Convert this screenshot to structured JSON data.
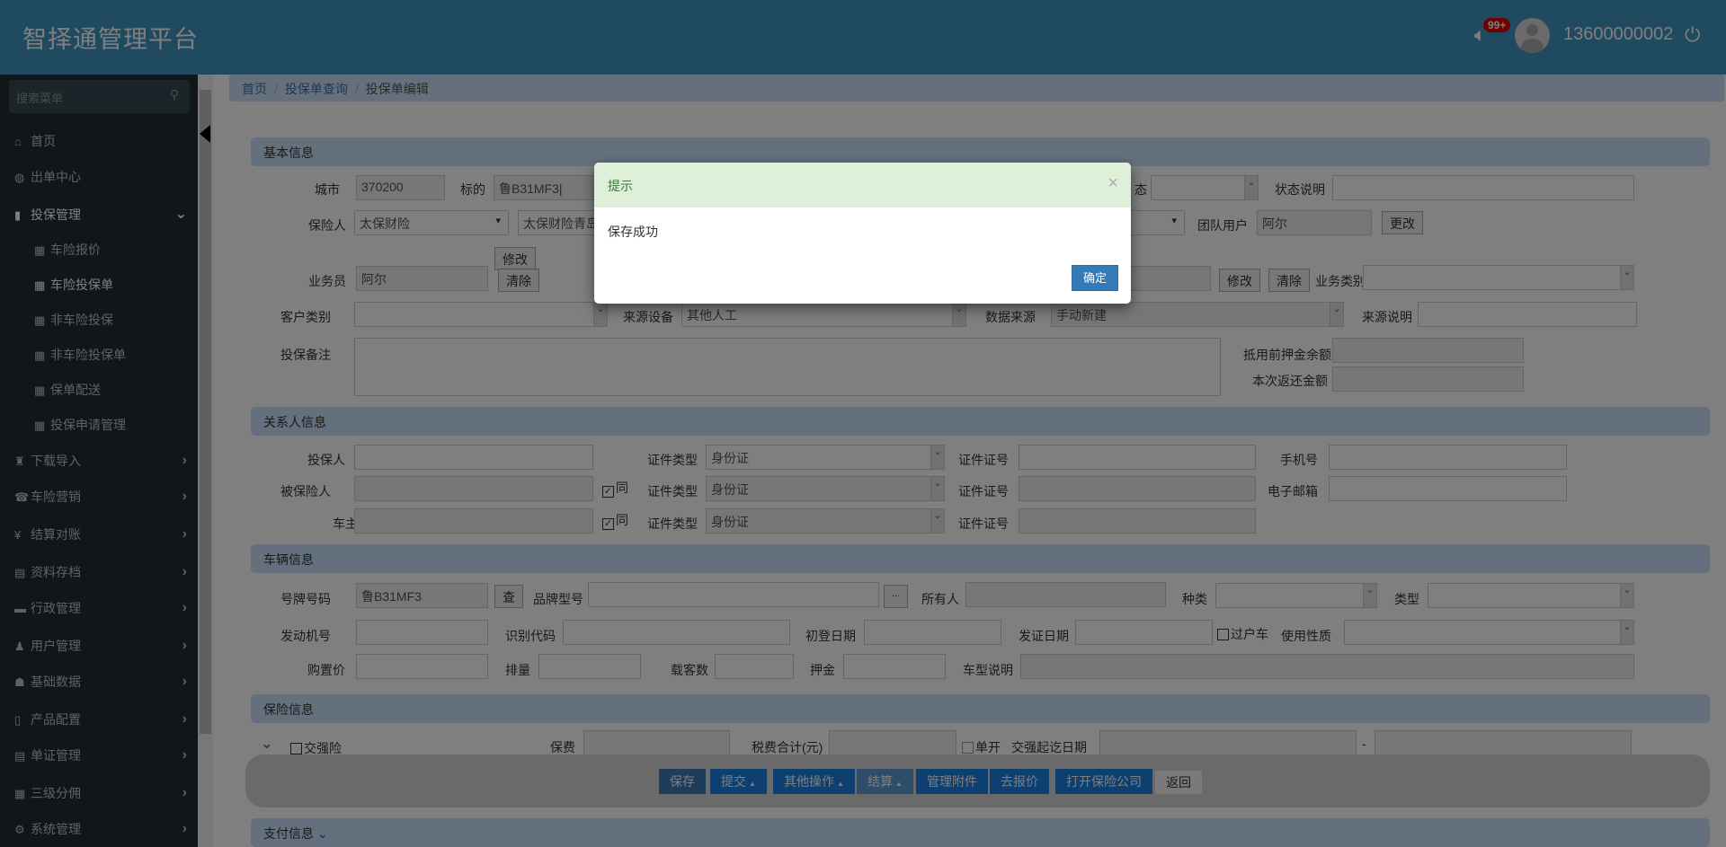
{
  "header": {
    "title": "智择通管理平台",
    "badge": "99+",
    "user": "13600000002"
  },
  "sidebar": {
    "search_placeholder": "搜索菜单",
    "items": [
      {
        "label": "首页",
        "icon": "home-icon"
      },
      {
        "label": "出单中心",
        "icon": "globe-icon"
      },
      {
        "label": "投保管理",
        "icon": "file-icon"
      },
      {
        "label": "车险报价"
      },
      {
        "label": "车险投保单"
      },
      {
        "label": "非车险投保"
      },
      {
        "label": "非车险投保单"
      },
      {
        "label": "保单配送"
      },
      {
        "label": "投保申请管理"
      },
      {
        "label": "下载导入"
      },
      {
        "label": "车险营销"
      },
      {
        "label": "结算对账"
      },
      {
        "label": "资料存档"
      },
      {
        "label": "行政管理"
      },
      {
        "label": "用户管理"
      },
      {
        "label": "基础数据"
      },
      {
        "label": "产品配置"
      },
      {
        "label": "单证管理"
      },
      {
        "label": "三级分佣"
      },
      {
        "label": "系统管理"
      }
    ]
  },
  "breadcrumb": [
    "首页",
    "投保单查询",
    "投保单编辑"
  ],
  "basic": {
    "title": "基本信息",
    "city_label": "城市",
    "city": "370200",
    "target_label": "标的",
    "target": "鲁B31MF3|",
    "status_label": "态",
    "status_desc_label": "状态说明",
    "insurer_label": "保险人",
    "insurer": "太保财险",
    "branch": "太保财险青岛",
    "team_label": "团队用户",
    "team": "阿尔",
    "change": "更改",
    "modify": "修改",
    "clear": "清除",
    "salesman_label": "业务员",
    "salesman": "阿尔",
    "biz_type_label": "业务类别",
    "cust_type_label": "客户类别",
    "src_device_label": "来源设备",
    "src_device": "其他人工",
    "data_src_label": "数据来源",
    "data_src": "手动新建",
    "src_desc_label": "来源说明",
    "remark_label": "投保备注",
    "deposit_label": "抵用前押金余额",
    "refund_label": "本次返还金额"
  },
  "contacts": {
    "title": "关系人信息",
    "applicant": "投保人",
    "insured": "被保险人",
    "owner": "车主",
    "same": "同",
    "id_type_label": "证件类型",
    "id_type": "身份证",
    "id_no_label": "证件证号",
    "phone_label": "手机号",
    "email_label": "电子邮箱"
  },
  "vehicle": {
    "title": "车辆信息",
    "plate_label": "号牌号码",
    "plate": "鲁B31MF3",
    "query": "查",
    "brand_label": "品牌型号",
    "more": "...",
    "owner_label": "所有人",
    "kind_label": "种类",
    "type_label": "类型",
    "engine_label": "发动机号",
    "vin_label": "识别代码",
    "reg_date_label": "初登日期",
    "issue_date_label": "发证日期",
    "transfer_label": "过户车",
    "usage_label": "使用性质",
    "price_label": "购置价",
    "displacement_label": "排量",
    "seats_label": "载客数",
    "deposit_label": "押金",
    "model_desc_label": "车型说明"
  },
  "insurance": {
    "title": "保险信息",
    "compulsory": "交强险",
    "premium_label": "保费",
    "tax_label": "税费合计(元)",
    "single_label": "单开",
    "period_label": "交强起讫日期",
    "dash": "-"
  },
  "actions": {
    "save": "保存",
    "submit": "提交",
    "other": "其他操作",
    "settle": "结算",
    "attach": "管理附件",
    "quote": "去报价",
    "open_company": "打开保险公司",
    "back": "返回"
  },
  "payment": {
    "title": "支付信息"
  },
  "modal": {
    "title": "提示",
    "message": "保存成功",
    "ok": "确定",
    "close": "×"
  }
}
